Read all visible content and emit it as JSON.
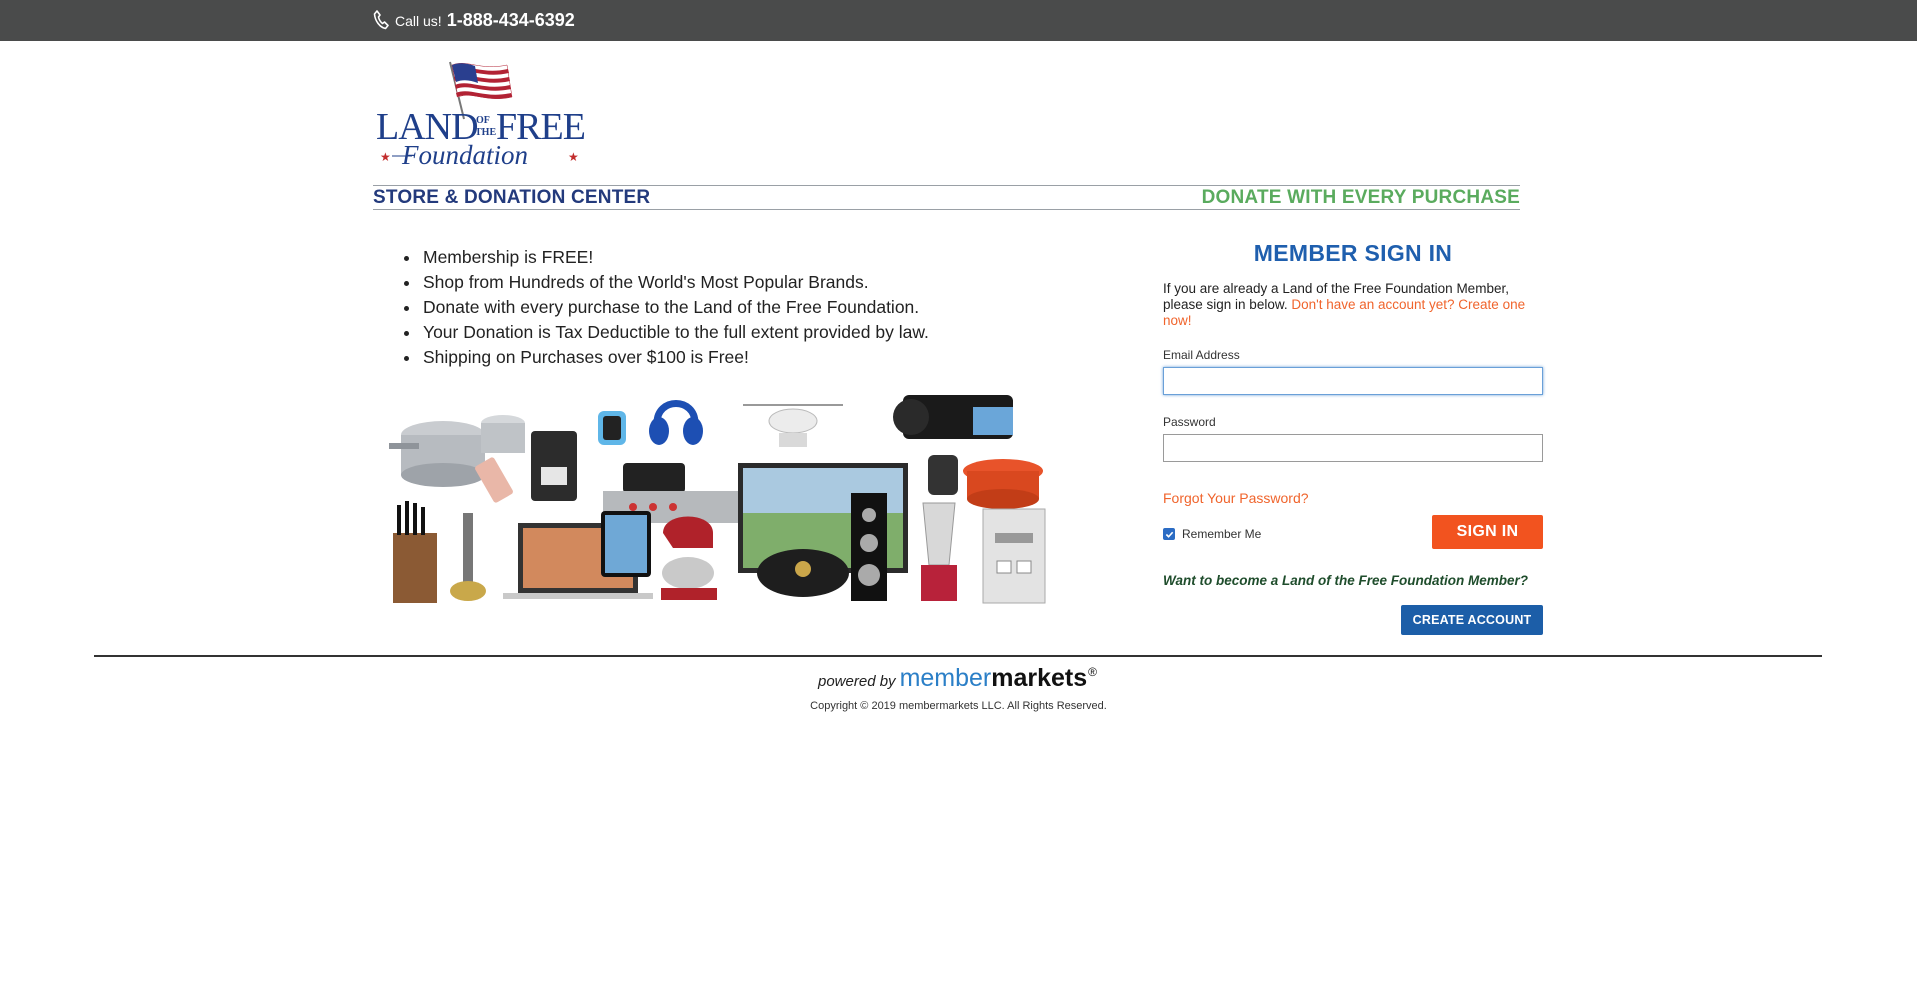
{
  "topbar": {
    "call_label": "Call us!",
    "phone_number": "1-888-434-6392",
    "phone_icon": "phone-icon",
    "background": "#4a4b4b"
  },
  "logo": {
    "line1_left": "LAND",
    "line1_small_top": "OF",
    "line1_small_bottom": "THE",
    "line1_right": "FREE",
    "line2": "Foundation",
    "icon": "american-flag-icon"
  },
  "banner": {
    "left_title": "STORE & DONATION CENTER",
    "right_title": "DONATE WITH EVERY PURCHASE",
    "left_color": "#233a7c",
    "right_color": "#5aab5e"
  },
  "benefits": [
    "Membership is FREE!",
    "Shop from Hundreds of the World's Most Popular Brands.",
    "Donate with every purchase to the Land of the Free Foundation.",
    "Your Donation is Tax Deductible to the full extent provided by law.",
    "Shipping on Purchases over $100 is Free!"
  ],
  "signin": {
    "title": "MEMBER SIGN IN",
    "intro_text": "If you are already a Land of the Free Foundation Member, please sign in below.",
    "intro_link": "Don't have an account yet? Create one now!",
    "email_label": "Email Address",
    "email_value": "",
    "password_label": "Password",
    "password_value": "",
    "forgot_link": "Forgot Your Password?",
    "remember_label": "Remember Me",
    "remember_checked": true,
    "signin_button": "SIGN IN",
    "become_text": "Want to become a Land of the Free Foundation Member?",
    "create_button": "CREATE ACCOUNT",
    "accent_color": "#f2531f",
    "title_color": "#1f5fae"
  },
  "footer": {
    "powered_by": "powered by",
    "brand_part1": "member",
    "brand_part2": "markets",
    "brand_reg": "®",
    "copyright": "Copyright © 2019 membermarkets LLC. All Rights Reserved."
  }
}
